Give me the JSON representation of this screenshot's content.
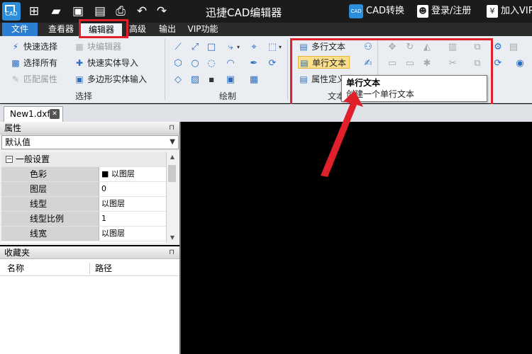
{
  "titlebar": {
    "app_logo_text": "CAD",
    "title": "迅捷CAD编辑器",
    "cad_convert_icon_text": "CAD",
    "cad_convert": "CAD转换",
    "login": "登录/注册",
    "join_vip": "加入VIP",
    "quick_access_icons": [
      "new-icon",
      "open-folder-icon",
      "save-icon",
      "save-as-icon",
      "print-icon",
      "undo-icon",
      "redo-icon"
    ]
  },
  "menubar": {
    "items": [
      "文件",
      "查看器",
      "编辑器",
      "高级",
      "输出",
      "VIP功能"
    ],
    "active": "编辑器"
  },
  "ribbon": {
    "select_group": {
      "name": "选择",
      "items": [
        "快速选择",
        "块编辑器",
        "选择所有",
        "快速实体导入",
        "匹配属性",
        "多边形实体输入"
      ]
    },
    "draw_group": {
      "name": "绘制"
    },
    "text_group": {
      "name": "文本",
      "items": [
        "多行文本",
        "单行文本",
        "属性定义"
      ]
    }
  },
  "tooltip": {
    "title": "单行文本",
    "description": "创建一个单行文本"
  },
  "document_tab": {
    "label": "New1.dxf"
  },
  "properties_panel": {
    "title": "属性",
    "dropdown_value": "默认值",
    "category": "一般设置",
    "rows": [
      {
        "name": "色彩",
        "value": "■ 以图层"
      },
      {
        "name": "图层",
        "value": "0"
      },
      {
        "name": "线型",
        "value": "以图层"
      },
      {
        "name": "线型比例",
        "value": "1"
      },
      {
        "name": "线宽",
        "value": "以图层"
      }
    ]
  },
  "favorites_panel": {
    "title": "收藏夹",
    "columns": [
      "名称",
      "路径"
    ]
  },
  "colors": {
    "accent_blue": "#2c7ed2",
    "highlight_red": "#e0202a",
    "selected_button": "#fbdf8c",
    "canvas": "#000000"
  }
}
